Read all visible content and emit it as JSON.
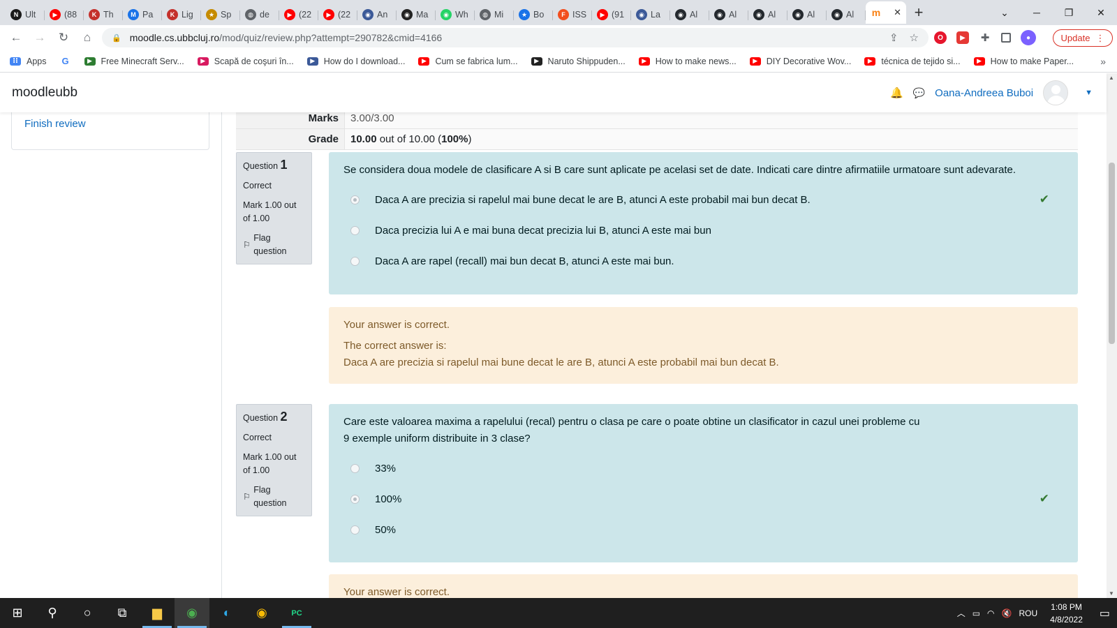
{
  "browser": {
    "tabs": [
      {
        "title": "Ult",
        "color": "#1a1a1a",
        "glyph": "N"
      },
      {
        "title": "(88",
        "color": "#ff0000",
        "glyph": "▶"
      },
      {
        "title": "Th",
        "color": "#c4302b",
        "glyph": "K"
      },
      {
        "title": "Pa",
        "color": "#1a73e8",
        "glyph": "M"
      },
      {
        "title": "Lig",
        "color": "#c4302b",
        "glyph": "K"
      },
      {
        "title": "Sp",
        "color": "#c58b00",
        "glyph": "★"
      },
      {
        "title": "de",
        "color": "#5f6368",
        "glyph": "◍"
      },
      {
        "title": "(22",
        "color": "#ff0000",
        "glyph": "▶"
      },
      {
        "title": "(22",
        "color": "#ff0000",
        "glyph": "▶"
      },
      {
        "title": "An",
        "color": "#3b5998",
        "glyph": "◉"
      },
      {
        "title": "Ma",
        "color": "#222222",
        "glyph": "◉"
      },
      {
        "title": "Wh",
        "color": "#25d366",
        "glyph": "◉"
      },
      {
        "title": "Mi",
        "color": "#5f6368",
        "glyph": "◍"
      },
      {
        "title": "Bo",
        "color": "#1a73e8",
        "glyph": "★"
      },
      {
        "title": "ISS",
        "color": "#f24e1e",
        "glyph": "F"
      },
      {
        "title": "(91",
        "color": "#ff0000",
        "glyph": "▶"
      },
      {
        "title": "La",
        "color": "#3b5998",
        "glyph": "◉"
      },
      {
        "title": "Al",
        "color": "#24292e",
        "glyph": "◉"
      },
      {
        "title": "Al",
        "color": "#24292e",
        "glyph": "◉"
      },
      {
        "title": "Al",
        "color": "#24292e",
        "glyph": "◉"
      },
      {
        "title": "Al",
        "color": "#24292e",
        "glyph": "◉"
      },
      {
        "title": "Al",
        "color": "#24292e",
        "glyph": "◉"
      }
    ],
    "active_tab_glyph": "m",
    "url_host": "moodle.cs.ubbcluj.ro",
    "url_path": "/mod/quiz/review.php?attempt=290782&cmid=4166",
    "update_label": "Update",
    "bookmarks": [
      {
        "label": "Apps",
        "color": "#4285f4"
      },
      {
        "label": "",
        "color": "#ffffff",
        "glyph": "G"
      },
      {
        "label": "Free Minecraft Serv...",
        "color": "#2e7d32"
      },
      {
        "label": "Scapă de coşuri în...",
        "color": "#d81b60"
      },
      {
        "label": "How do I download...",
        "color": "#3b5998"
      },
      {
        "label": "Cum se fabrica lum...",
        "color": "#ff0000"
      },
      {
        "label": "Naruto Shippuden...",
        "color": "#222222"
      },
      {
        "label": "How to make news...",
        "color": "#ff0000"
      },
      {
        "label": "DIY Decorative Wov...",
        "color": "#ff0000"
      },
      {
        "label": "técnica de tejido si...",
        "color": "#ff0000"
      },
      {
        "label": "How to make Paper...",
        "color": "#ff0000"
      }
    ]
  },
  "moodle": {
    "brand": "moodleubb",
    "user_name": "Oana-Andreea Buboi",
    "finish_review": "Finish review",
    "summary": {
      "marks_label": "Marks",
      "marks_value": "3.00/3.00",
      "grade_label": "Grade",
      "grade_value_bold": "10.00",
      "grade_value_mid": " out of 10.00 (",
      "grade_percent": "100%",
      "grade_value_end": ")"
    },
    "questions": [
      {
        "word": "Question",
        "number": "1",
        "state": "Correct",
        "mark": "Mark 1.00 out of 1.00",
        "flag": "Flag question",
        "text": "Se considera doua modele de clasificare A si B care sunt aplicate pe acelasi set de date. Indicati care dintre afirmatiile urmatoare sunt adevarate.",
        "options": [
          "Daca A are precizia si rapelul mai bune decat le are B, atunci A este probabil mai bun decat B.",
          "Daca precizia lui A e mai buna decat precizia lui B, atunci A este mai bun",
          "Daca A are rapel (recall) mai bun decat B, atunci A este mai bun."
        ],
        "feedback": "Your answer is correct.",
        "right_answer_label": "The correct answer is:",
        "right_answer": "Daca A are precizia si rapelul mai bune decat le are B, atunci A este probabil mai bun decat B."
      },
      {
        "word": "Question",
        "number": "2",
        "state": "Correct",
        "mark": "Mark 1.00 out of 1.00",
        "flag": "Flag question",
        "text_line1": "Care este valoarea maxima a rapelului (recal) pentru o clasa pe care o poate obtine un clasificator in cazul unei probleme cu",
        "text_line2": "9 exemple uniform distribuite in 3 clase?",
        "options": [
          "33%",
          "100%",
          "50%"
        ],
        "feedback": "Your answer is correct."
      }
    ]
  },
  "taskbar": {
    "time": "1:08 PM",
    "date": "4/8/2022",
    "lang": "ROU"
  }
}
